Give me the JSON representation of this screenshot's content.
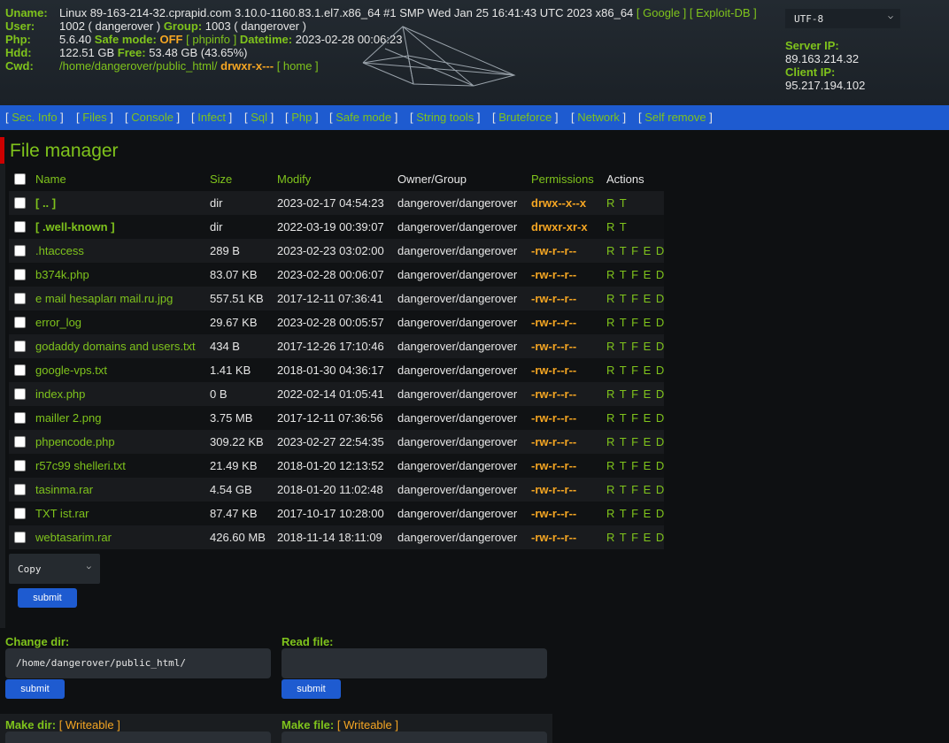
{
  "header": {
    "uname_label": "Uname:",
    "uname_value": "Linux 89-163-214-32.cprapid.com 3.10.0-1160.83.1.el7.x86_64 #1 SMP Wed Jan 25 16:41:43 UTC 2023 x86_64",
    "google_link": "[ Google ]",
    "exploitdb_link": "[ Exploit-DB ]",
    "user_label": "User:",
    "user_value": "1002 ( dangerover )",
    "group_label": "Group:",
    "group_value": "1003 ( dangerover )",
    "php_label": "Php:",
    "php_version": "5.6.40",
    "safe_mode_label": "Safe mode:",
    "safe_mode_value": "OFF",
    "phpinfo_link": "[ phpinfo ]",
    "datetime_label": "Datetime:",
    "datetime_value": "2023-02-28 00:06:23",
    "hdd_label": "Hdd:",
    "hdd_total": "122.51 GB",
    "free_label": "Free:",
    "hdd_free": "53.48 GB (43.65%)",
    "cwd_label": "Cwd:",
    "cwd_path": "/home/dangerover/public_html/",
    "cwd_perms": "drwxr-x---",
    "home_link": "[ home ]",
    "encoding": "UTF-8",
    "server_ip_label": "Server IP:",
    "server_ip": "89.163.214.32",
    "client_ip_label": "Client IP:",
    "client_ip": "95.217.194.102"
  },
  "menu": [
    {
      "label": "Sec. Info"
    },
    {
      "label": "Files"
    },
    {
      "label": "Console"
    },
    {
      "label": "Infect"
    },
    {
      "label": "Sql"
    },
    {
      "label": "Php"
    },
    {
      "label": "Safe mode"
    },
    {
      "label": "String tools"
    },
    {
      "label": "Bruteforce"
    },
    {
      "label": "Network"
    },
    {
      "label": "Self remove"
    }
  ],
  "file_manager": {
    "title": "File manager",
    "columns": {
      "name": "Name",
      "size": "Size",
      "modify": "Modify",
      "owner": "Owner/Group",
      "permissions": "Permissions",
      "actions": "Actions"
    },
    "rows": [
      {
        "name": "[ .. ]",
        "size": "dir",
        "modify": "2023-02-17 04:54:23",
        "owner": "dangerover/dangerover",
        "perms": "drwx--x--x",
        "actions": "R T",
        "dir": true
      },
      {
        "name": "[ .well-known ]",
        "size": "dir",
        "modify": "2022-03-19 00:39:07",
        "owner": "dangerover/dangerover",
        "perms": "drwxr-xr-x",
        "actions": "R T",
        "dir": true
      },
      {
        "name": ".htaccess",
        "size": "289 B",
        "modify": "2023-02-23 03:02:00",
        "owner": "dangerover/dangerover",
        "perms": "-rw-r--r--",
        "actions": "R T F E D"
      },
      {
        "name": "b374k.php",
        "size": "83.07 KB",
        "modify": "2023-02-28 00:06:07",
        "owner": "dangerover/dangerover",
        "perms": "-rw-r--r--",
        "actions": "R T F E D"
      },
      {
        "name": "e mail hesapları mail.ru.jpg",
        "size": "557.51 KB",
        "modify": "2017-12-11 07:36:41",
        "owner": "dangerover/dangerover",
        "perms": "-rw-r--r--",
        "actions": "R T F E D"
      },
      {
        "name": "error_log",
        "size": "29.67 KB",
        "modify": "2023-02-28 00:05:57",
        "owner": "dangerover/dangerover",
        "perms": "-rw-r--r--",
        "actions": "R T F E D"
      },
      {
        "name": "godaddy domains and users.txt",
        "size": "434 B",
        "modify": "2017-12-26 17:10:46",
        "owner": "dangerover/dangerover",
        "perms": "-rw-r--r--",
        "actions": "R T F E D"
      },
      {
        "name": "google-vps.txt",
        "size": "1.41 KB",
        "modify": "2018-01-30 04:36:17",
        "owner": "dangerover/dangerover",
        "perms": "-rw-r--r--",
        "actions": "R T F E D"
      },
      {
        "name": "index.php",
        "size": "0 B",
        "modify": "2022-02-14 01:05:41",
        "owner": "dangerover/dangerover",
        "perms": "-rw-r--r--",
        "actions": "R T F E D"
      },
      {
        "name": "mailler 2.png",
        "size": "3.75 MB",
        "modify": "2017-12-11 07:36:56",
        "owner": "dangerover/dangerover",
        "perms": "-rw-r--r--",
        "actions": "R T F E D"
      },
      {
        "name": "phpencode.php",
        "size": "309.22 KB",
        "modify": "2023-02-27 22:54:35",
        "owner": "dangerover/dangerover",
        "perms": "-rw-r--r--",
        "actions": "R T F E D"
      },
      {
        "name": "r57c99 shelleri.txt",
        "size": "21.49 KB",
        "modify": "2018-01-20 12:13:52",
        "owner": "dangerover/dangerover",
        "perms": "-rw-r--r--",
        "actions": "R T F E D"
      },
      {
        "name": "tasinma.rar",
        "size": "4.54 GB",
        "modify": "2018-01-20 11:02:48",
        "owner": "dangerover/dangerover",
        "perms": "-rw-r--r--",
        "actions": "R T F E D"
      },
      {
        "name": "TXT ist.rar",
        "size": "87.47 KB",
        "modify": "2017-10-17 10:28:00",
        "owner": "dangerover/dangerover",
        "perms": "-rw-r--r--",
        "actions": "R T F E D"
      },
      {
        "name": "webtasarim.rar",
        "size": "426.60 MB",
        "modify": "2018-11-14 18:11:09",
        "owner": "dangerover/dangerover",
        "perms": "-rw-r--r--",
        "actions": "R T F E D"
      }
    ],
    "action_select": "Copy",
    "submit_label": "submit"
  },
  "forms": {
    "change_dir_label": "Change dir:",
    "change_dir_value": "/home/dangerover/public_html/",
    "read_file_label": "Read file:",
    "submit_label": "submit",
    "make_dir_label": "Make dir:",
    "make_file_label": "Make file:",
    "writeable": "[ Writeable ]"
  },
  "colors": {
    "accent_green": "#7fc31c",
    "menu_blue": "#1e5bd0",
    "perm_orange": "#f5a623",
    "title_red": "#cc0000"
  }
}
